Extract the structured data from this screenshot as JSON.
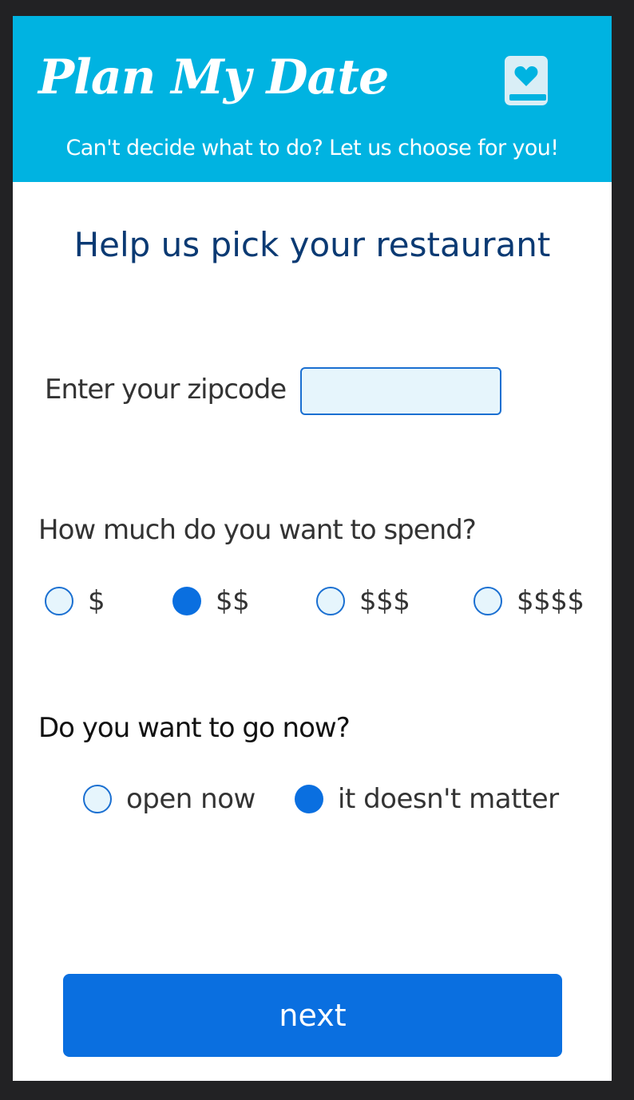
{
  "header": {
    "title": "Plan My Date",
    "tagline": "Can't decide what to do? Let us choose for you!",
    "icon": "heart-book-icon",
    "background_color": "#00b3e1"
  },
  "main": {
    "heading": "Help us pick your restaurant",
    "zipcode": {
      "label": "Enter your zipcode",
      "value": "",
      "placeholder": ""
    },
    "spend": {
      "question": "How much do you want to spend?",
      "options": [
        {
          "label": "$",
          "selected": false
        },
        {
          "label": "$$",
          "selected": true
        },
        {
          "label": "$$$",
          "selected": false
        },
        {
          "label": "$$$$",
          "selected": false
        }
      ]
    },
    "availability": {
      "question": "Do you want to go now?",
      "options": [
        {
          "label": "open now",
          "selected": false
        },
        {
          "label": "it doesn't matter",
          "selected": true
        }
      ]
    }
  },
  "footer": {
    "next_label": "next"
  },
  "colors": {
    "accent": "#0a6fe0",
    "heading": "#0b3a73",
    "input_bg": "#e6f5fc"
  }
}
